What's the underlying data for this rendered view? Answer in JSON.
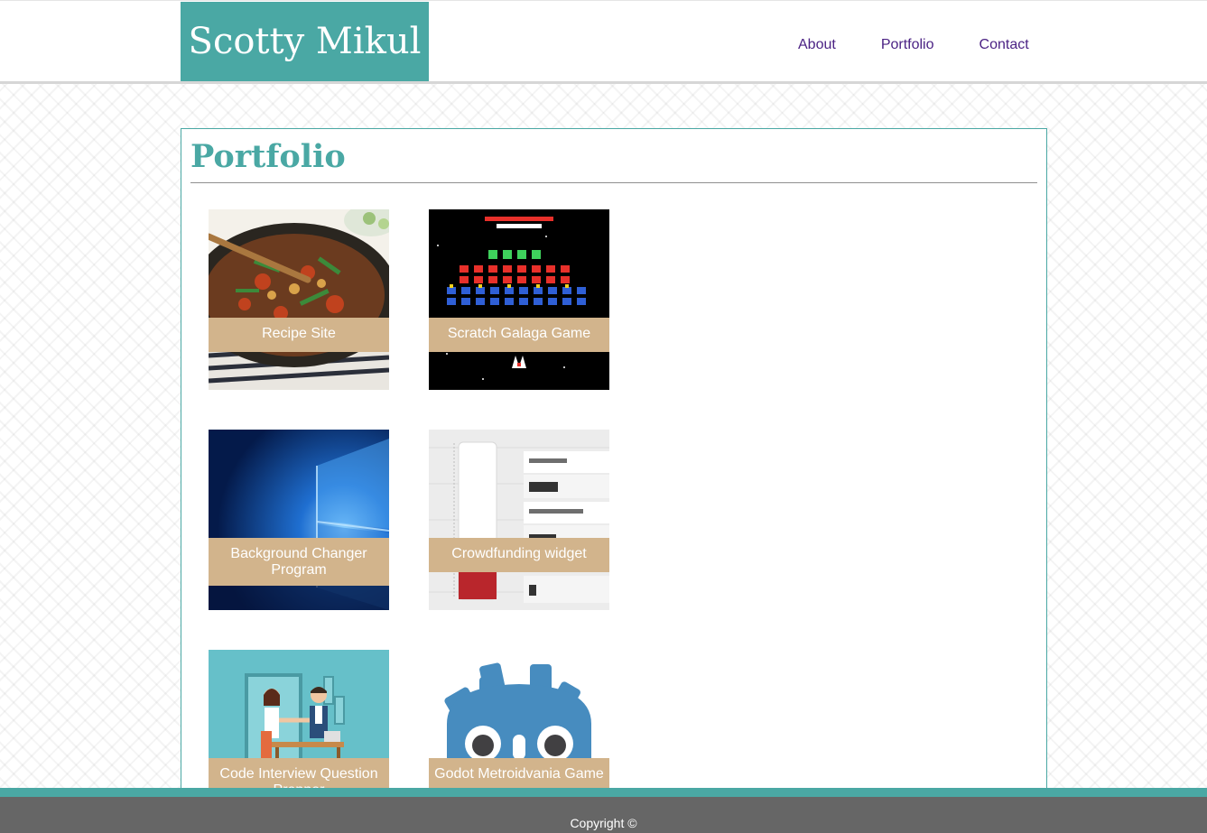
{
  "header": {
    "brand": "Scotty Mikul",
    "nav": [
      "About",
      "Portfolio",
      "Contact"
    ]
  },
  "main": {
    "title": "Portfolio",
    "projects": [
      {
        "label": "Recipe Site",
        "image": "stir-fry-wok-image"
      },
      {
        "label": "Scratch Galaga Game",
        "image": "galaga-screenshot-image"
      },
      {
        "label": "Background Changer Program",
        "image": "windows-wallpaper-image"
      },
      {
        "label": "Crowdfunding widget",
        "image": "crowdfunding-thermometer-image"
      },
      {
        "label": "Code Interview Question Prepper",
        "image": "interview-illustration-image"
      },
      {
        "label": "Godot Metroidvania Game",
        "image": "godot-logo-image"
      }
    ]
  },
  "footer": {
    "copyright": "Copyright ©"
  },
  "colors": {
    "brand_teal": "#4aa8a4",
    "caption_tan": "#d2b48c",
    "nav_purple": "#4b2284",
    "footer_gray": "#666666"
  }
}
